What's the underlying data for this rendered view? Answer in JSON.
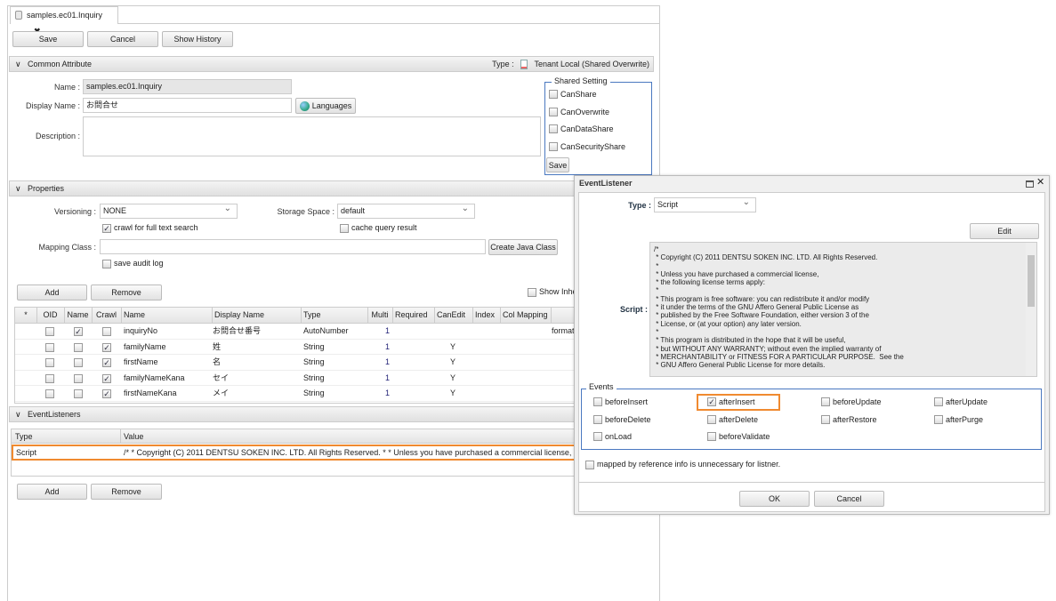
{
  "tab": {
    "title": "samples.ec01.Inquiry",
    "close": "✖"
  },
  "toolbar": {
    "save": "Save",
    "cancel": "Cancel",
    "history": "Show History"
  },
  "common": {
    "title": "Common Attribute",
    "type_label": "Type :",
    "type_value": "Tenant Local (Shared Overwrite)",
    "name_label": "Name :",
    "name_value": "samples.ec01.Inquiry",
    "display_label": "Display Name :",
    "display_value": "お問合せ",
    "languages": "Languages",
    "desc_label": "Description :",
    "desc_value": "",
    "shared": {
      "legend": "Shared Setting",
      "items": [
        {
          "label": "CanShare",
          "checked": false
        },
        {
          "label": "CanOverwrite",
          "checked": false
        },
        {
          "label": "CanDataShare",
          "checked": false
        },
        {
          "label": "CanSecurityShare",
          "checked": false
        }
      ],
      "save": "Save"
    }
  },
  "props": {
    "title": "Properties",
    "versioning_label": "Versioning :",
    "versioning": "NONE",
    "storage_label": "Storage Space :",
    "storage": "default",
    "crawl": "crawl for full text search",
    "crawl_checked": true,
    "cache": "cache query result",
    "cache_checked": false,
    "mapping_label": "Mapping Class :",
    "mapping_value": "",
    "create_java": "Create Java Class",
    "audit": "save audit log",
    "audit_checked": false,
    "add": "Add",
    "remove": "Remove",
    "show_inherited": "Show Inhe",
    "columns": [
      "*",
      "OID",
      "Name",
      "Crawl",
      "Name",
      "Display Name",
      "Type",
      "Multi",
      "Required",
      "CanEdit",
      "Index",
      "Col Mapping"
    ],
    "rows": [
      {
        "oid": false,
        "name_flag": true,
        "crawl": false,
        "name": "inquiryNo",
        "display": "お問合せ番号",
        "type": "AutoNumber",
        "multi": "1",
        "canedit": "",
        "extra": "format"
      },
      {
        "oid": false,
        "name_flag": false,
        "crawl": true,
        "name": "familyName",
        "display": "姓",
        "type": "String",
        "multi": "1",
        "canedit": "Y",
        "extra": ""
      },
      {
        "oid": false,
        "name_flag": false,
        "crawl": true,
        "name": "firstName",
        "display": "名",
        "type": "String",
        "multi": "1",
        "canedit": "Y",
        "extra": ""
      },
      {
        "oid": false,
        "name_flag": false,
        "crawl": true,
        "name": "familyNameKana",
        "display": "セイ",
        "type": "String",
        "multi": "1",
        "canedit": "Y",
        "extra": ""
      },
      {
        "oid": false,
        "name_flag": false,
        "crawl": true,
        "name": "firstNameKana",
        "display": "メイ",
        "type": "String",
        "multi": "1",
        "canedit": "Y",
        "extra": ""
      }
    ]
  },
  "listeners": {
    "title": "EventListeners",
    "col_type": "Type",
    "col_value": "Value",
    "rows": [
      {
        "type": "Script",
        "value": "/* * Copyright (C) 2011 DENTSU SOKEN INC. LTD. All Rights Reserved. * * Unless you have purchased a commercial license, * the follow"
      }
    ],
    "add": "Add",
    "remove": "Remove"
  },
  "dialog": {
    "title": "EventListener",
    "type_label": "Type :",
    "type_value": "Script",
    "edit": "Edit",
    "script_label": "Script :",
    "script": "/*\n * Copyright (C) 2011 DENTSU SOKEN INC. LTD. All Rights Reserved.\n *\n * Unless you have purchased a commercial license,\n * the following license terms apply:\n *\n * This program is free software: you can redistribute it and/or modify\n * it under the terms of the GNU Affero General Public License as\n * published by the Free Software Foundation, either version 3 of the\n * License, or (at your option) any later version.\n *\n * This program is distributed in the hope that it will be useful,\n * but WITHOUT ANY WARRANTY; without even the implied warranty of\n * MERCHANTABILITY or FITNESS FOR A PARTICULAR PURPOSE.  See the\n * GNU Affero General Public License for more details.",
    "events_legend": "Events",
    "events": [
      {
        "label": "beforeInsert",
        "checked": false
      },
      {
        "label": "afterInsert",
        "checked": true
      },
      {
        "label": "beforeUpdate",
        "checked": false
      },
      {
        "label": "afterUpdate",
        "checked": false
      },
      {
        "label": "beforeDelete",
        "checked": false
      },
      {
        "label": "afterDelete",
        "checked": false
      },
      {
        "label": "afterRestore",
        "checked": false
      },
      {
        "label": "afterPurge",
        "checked": false
      },
      {
        "label": "onLoad",
        "checked": false
      },
      {
        "label": "beforeValidate",
        "checked": false
      }
    ],
    "mapped": "mapped by reference info is unnecessary for listner.",
    "mapped_checked": false,
    "ok": "OK",
    "cancel": "Cancel"
  },
  "colors": {
    "highlight": "#f08a30",
    "fieldset": "#4a78c0",
    "header_bg": "#e6e6e6"
  }
}
